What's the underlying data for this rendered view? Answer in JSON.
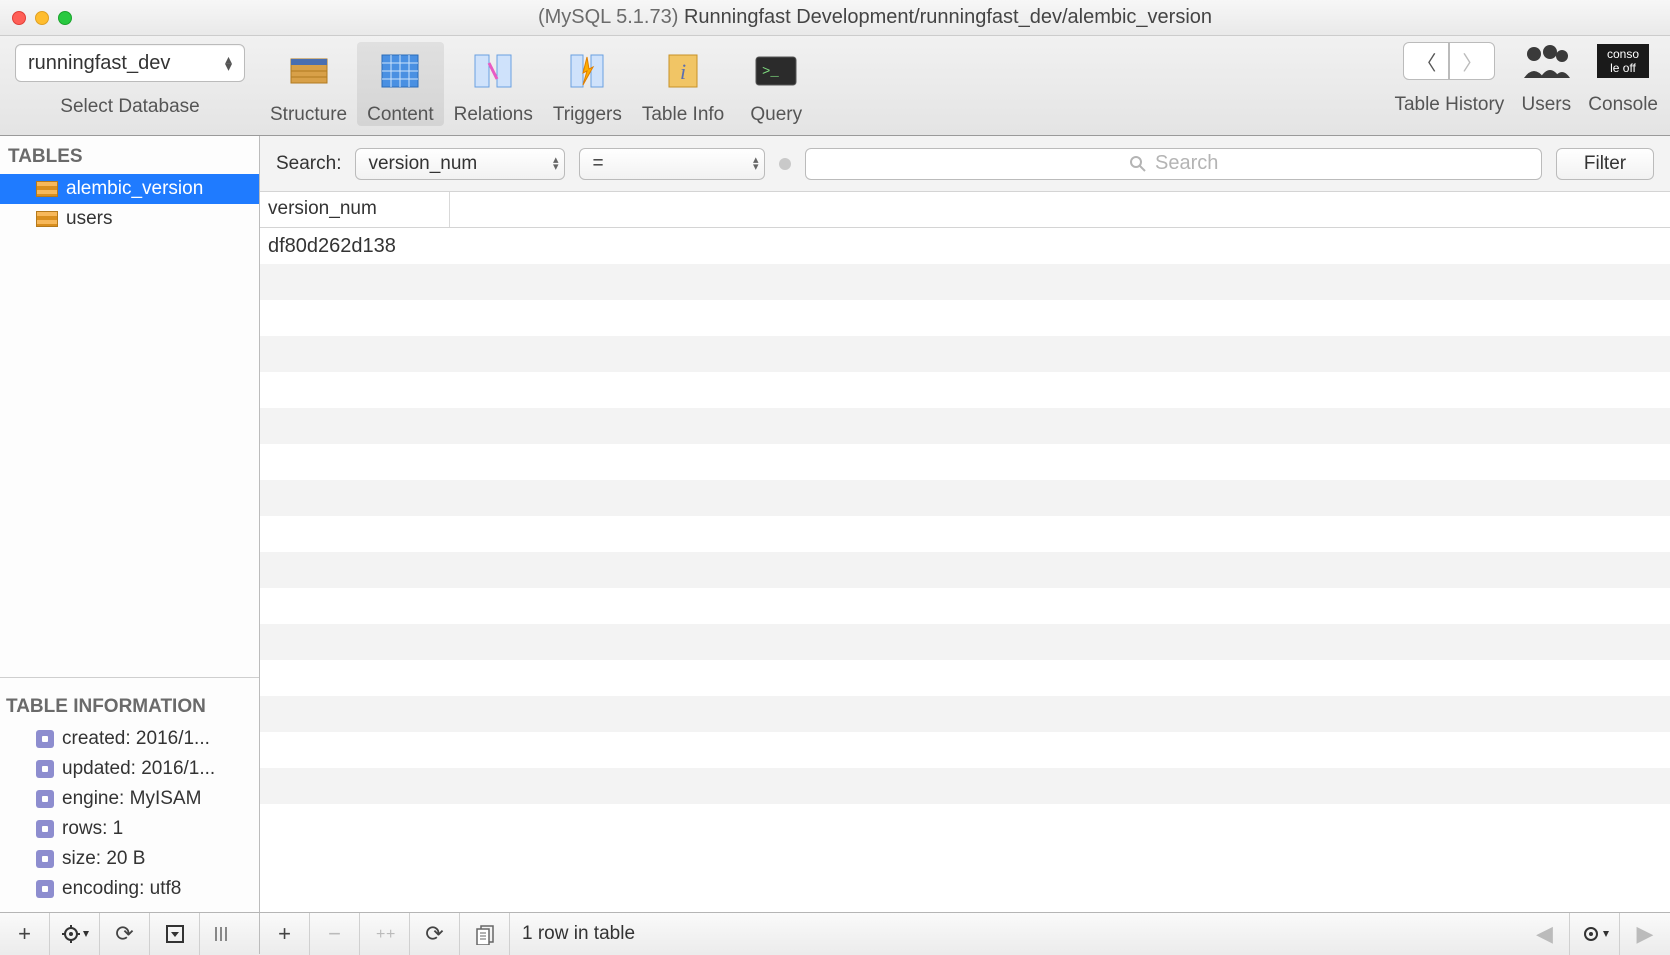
{
  "window": {
    "title_prefix": "(MySQL 5.1.73) ",
    "title_main": "Runningfast Development/runningfast_dev/alembic_version"
  },
  "toolbar": {
    "db_selected": "runningfast_dev",
    "db_label": "Select Database",
    "items": [
      {
        "id": "structure",
        "label": "Structure"
      },
      {
        "id": "content",
        "label": "Content"
      },
      {
        "id": "relations",
        "label": "Relations"
      },
      {
        "id": "triggers",
        "label": "Triggers"
      },
      {
        "id": "tableinfo",
        "label": "Table Info"
      },
      {
        "id": "query",
        "label": "Query"
      }
    ],
    "active": "content",
    "history_label": "Table History",
    "users_label": "Users",
    "console_label": "Console"
  },
  "sidebar": {
    "tables_header": "TABLES",
    "tables": [
      {
        "name": "alembic_version",
        "selected": true
      },
      {
        "name": "users",
        "selected": false
      }
    ],
    "info_header": "TABLE INFORMATION",
    "info": [
      {
        "label": "created: 2016/1..."
      },
      {
        "label": "updated: 2016/1..."
      },
      {
        "label": "engine: MyISAM"
      },
      {
        "label": "rows: 1"
      },
      {
        "label": "size: 20 B"
      },
      {
        "label": "encoding: utf8"
      }
    ]
  },
  "search": {
    "label": "Search:",
    "field": "version_num",
    "operator": "=",
    "placeholder": "Search",
    "filter_label": "Filter"
  },
  "grid": {
    "columns": [
      "version_num"
    ],
    "rows": [
      {
        "version_num": "df80d262d138"
      }
    ],
    "blank_rows": 15
  },
  "statusbar": {
    "text": "1 row in table"
  }
}
